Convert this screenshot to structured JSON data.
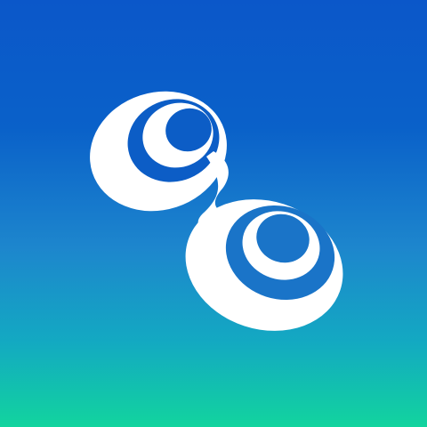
{
  "app_icon": {
    "icon": "infinity-swirl-logo-icon",
    "colors": {
      "gradient_top": "#0b57c9",
      "gradient_bottom": "#12d49e",
      "logo": "#ffffff"
    }
  }
}
